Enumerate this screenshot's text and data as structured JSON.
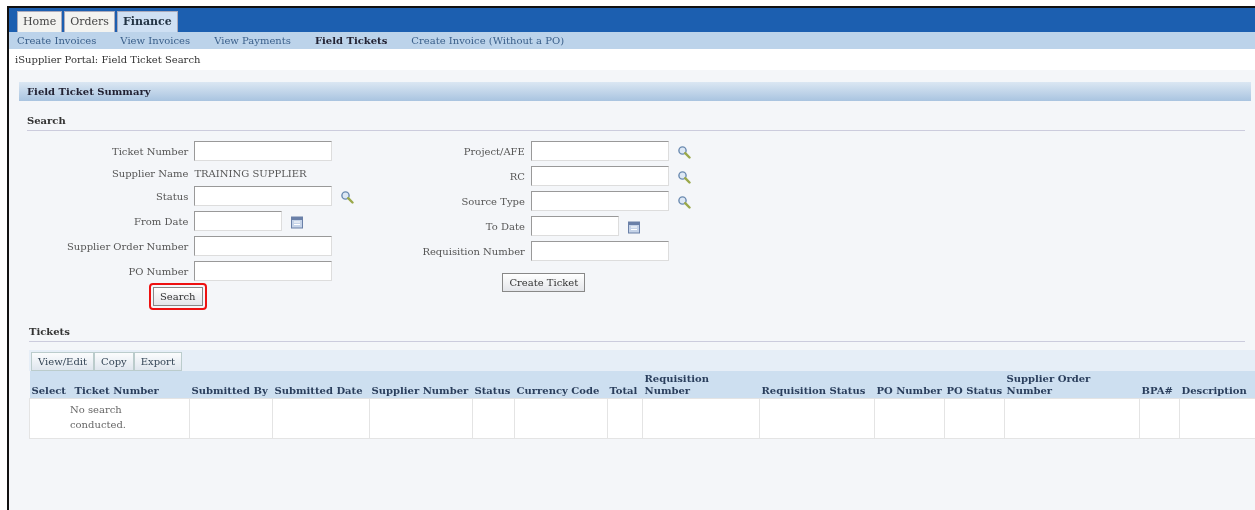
{
  "tabs": [
    {
      "label": "Home",
      "selected": false
    },
    {
      "label": "Orders",
      "selected": false
    },
    {
      "label": "Finance",
      "selected": true
    }
  ],
  "subtabs": [
    {
      "label": "Create Invoices",
      "selected": false
    },
    {
      "label": "View Invoices",
      "selected": false
    },
    {
      "label": "View Payments",
      "selected": false
    },
    {
      "label": "Field Tickets",
      "selected": true
    },
    {
      "label": "Create Invoice (Without a PO)",
      "selected": false
    }
  ],
  "breadcrumb": "iSupplier Portal: Field Ticket Search",
  "page_header": "Field Ticket Summary",
  "search": {
    "title": "Search",
    "left_fields": [
      {
        "label": "Ticket Number",
        "kind": "text"
      },
      {
        "label": "Supplier Name",
        "kind": "display",
        "value": "TRAINING SUPPLIER"
      },
      {
        "label": "Status",
        "kind": "lov"
      },
      {
        "label": "From Date",
        "kind": "date"
      },
      {
        "label": "Supplier Order Number",
        "kind": "text"
      },
      {
        "label": "PO Number",
        "kind": "text"
      }
    ],
    "right_fields": [
      {
        "label": "Project/AFE",
        "kind": "lov"
      },
      {
        "label": "RC",
        "kind": "lov"
      },
      {
        "label": "Source Type",
        "kind": "lov"
      },
      {
        "label": "To Date",
        "kind": "date"
      },
      {
        "label": "Requisition Number",
        "kind": "text"
      }
    ],
    "search_button": {
      "label": "Search",
      "highlighted": true
    },
    "create_button": {
      "label": "Create Ticket"
    }
  },
  "tickets": {
    "title": "Tickets",
    "buttons": [
      "View/Edit",
      "Copy",
      "Export"
    ],
    "columns": [
      "Select",
      "Ticket Number",
      "Submitted By",
      "Submitted Date",
      "Supplier Number",
      "Status",
      "Currency Code",
      "Total",
      "Requisition Number",
      "Requisition Status",
      "PO Number",
      "PO Status",
      "Supplier Order Number",
      "BPA#",
      "Description"
    ],
    "empty_message": "No search conducted."
  }
}
